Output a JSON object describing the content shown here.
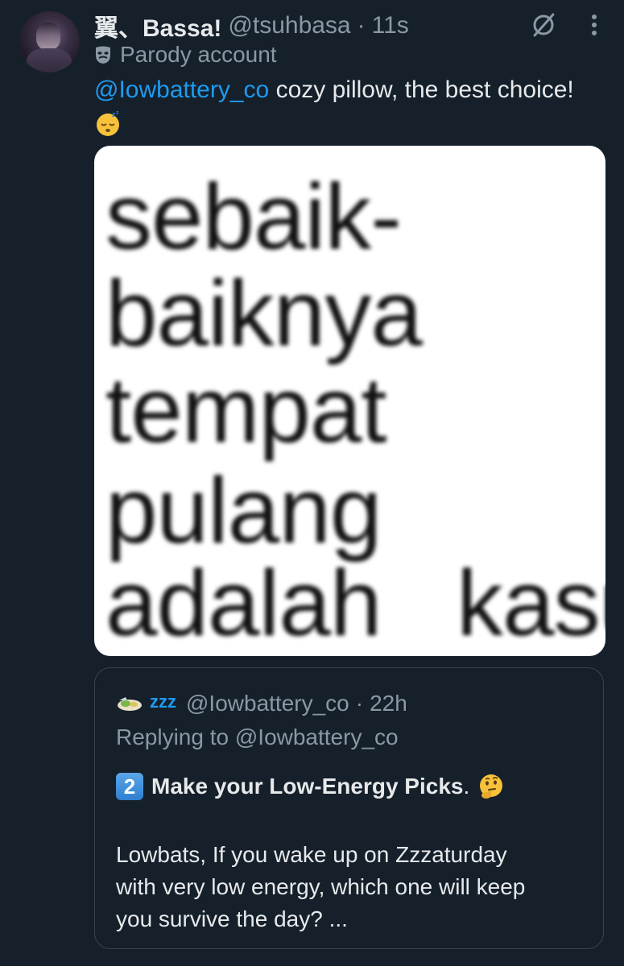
{
  "tweet": {
    "display_name": "翼、Bassa!",
    "handle": "@tsuhbasa",
    "separator": "·",
    "time": "11s",
    "label": "Parody account",
    "mention": "@Iowbattery_co",
    "text": " cozy pillow, the best choice!",
    "emoji": "sleeping-face-emoji"
  },
  "media": {
    "lines": [
      "sebaik-",
      "baiknya",
      "tempat",
      "pulang",
      "adalah   kasur"
    ]
  },
  "quote": {
    "zzz": "zzz",
    "handle": "@Iowbattery_co",
    "separator": "·",
    "time": "22h",
    "replying": "Replying to @Iowbattery_co",
    "keycap": "2",
    "title": "Make your Low-Energy Picks",
    "title_end": ".",
    "body_line1": "Lowbats, If you wake up on Zzzaturday",
    "body_line2": "with very low energy, which one will keep",
    "body_line3": "you survive the day? ..."
  },
  "colors": {
    "background": "#15202b",
    "primary_text": "#e7e9ea",
    "secondary_text": "#8b98a5",
    "accent": "#1d9bf0",
    "border": "#38444d"
  }
}
